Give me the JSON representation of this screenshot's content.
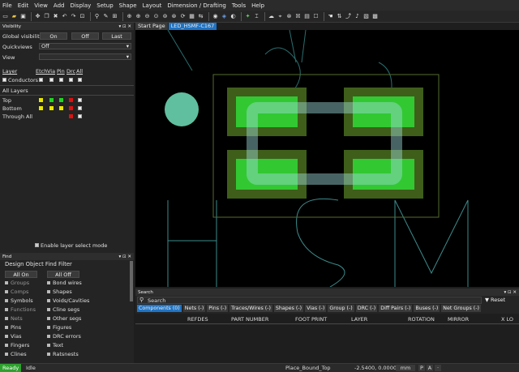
{
  "menu": [
    "File",
    "Edit",
    "View",
    "Add",
    "Display",
    "Setup",
    "Shape",
    "Layout",
    "Dimension / Drafting",
    "Tools",
    "Help"
  ],
  "visibility": {
    "title": "Visibility",
    "global_label": "Global visibility",
    "on": "On",
    "off": "Off",
    "last": "Last",
    "quickviews_label": "Quickviews",
    "quickviews_value": "Off",
    "view_label": "View",
    "layer_hdr": "Layer",
    "cols": [
      "Etch",
      "Via",
      "Pin",
      "Drc",
      "All"
    ],
    "conductors": "Conductors",
    "all_layers": "All Layers",
    "rows": [
      "Top",
      "Bottom",
      "Through All"
    ],
    "enable_select": "Enable layer select mode"
  },
  "find": {
    "title": "Find",
    "filter_title": "Design Object Find Filter",
    "all_on": "All On",
    "all_off": "All Off",
    "left": [
      "Groups",
      "Comps",
      "Symbols",
      "Functions",
      "Nets",
      "Pins",
      "Vias",
      "Fingers",
      "Clines"
    ],
    "right": [
      "Bond wires",
      "Shapes",
      "Voids/Cavities",
      "Cline segs",
      "Other segs",
      "Figures",
      "DRC errors",
      "Text",
      "Ratsnests"
    ]
  },
  "doc_tabs": [
    "Start Page",
    "LED_HSMF-C167"
  ],
  "search": {
    "title": "Search",
    "placeholder": "Search",
    "reset": "Reset",
    "tabs": [
      "Components (0)",
      "Nets (-)",
      "Pins (-)",
      "Traces/Wires (-)",
      "Shapes (-)",
      "Vias (-)",
      "Group (-)",
      "DRC (-)",
      "Diff Pairs (-)",
      "Buses (-)",
      "Net Groups (-)"
    ],
    "columns": [
      "REFDES",
      "PART NUMBER",
      "FOOT PRINT",
      "LAYER",
      "ROTATION",
      "MIRROR",
      "X LO"
    ]
  },
  "status": {
    "ready": "Ready",
    "idle": "Idle",
    "mode": "Place_Bound_Top",
    "coords": "-2.5400, 0.0000",
    "units": "mm",
    "p": "P",
    "a": "A"
  },
  "colors": {
    "accent": "#1f73c3",
    "pad_green": "#32c832",
    "outline_cyan": "#3c8c8c",
    "ready_green": "#2ea12e"
  }
}
